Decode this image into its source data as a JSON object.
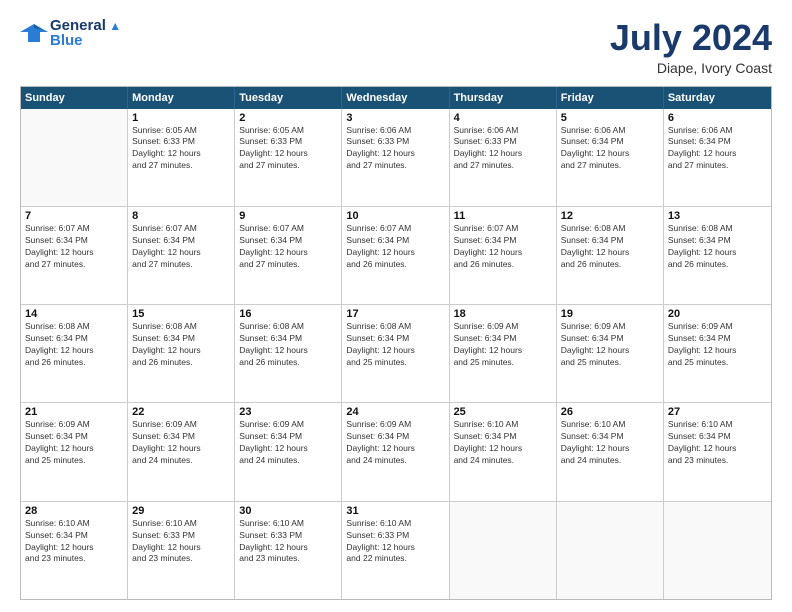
{
  "header": {
    "logo_line1": "General",
    "logo_line2": "Blue",
    "month_year": "July 2024",
    "location": "Diape, Ivory Coast"
  },
  "days_of_week": [
    "Sunday",
    "Monday",
    "Tuesday",
    "Wednesday",
    "Thursday",
    "Friday",
    "Saturday"
  ],
  "weeks": [
    [
      {
        "day": "",
        "info": ""
      },
      {
        "day": "1",
        "info": "Sunrise: 6:05 AM\nSunset: 6:33 PM\nDaylight: 12 hours\nand 27 minutes."
      },
      {
        "day": "2",
        "info": "Sunrise: 6:05 AM\nSunset: 6:33 PM\nDaylight: 12 hours\nand 27 minutes."
      },
      {
        "day": "3",
        "info": "Sunrise: 6:06 AM\nSunset: 6:33 PM\nDaylight: 12 hours\nand 27 minutes."
      },
      {
        "day": "4",
        "info": "Sunrise: 6:06 AM\nSunset: 6:33 PM\nDaylight: 12 hours\nand 27 minutes."
      },
      {
        "day": "5",
        "info": "Sunrise: 6:06 AM\nSunset: 6:34 PM\nDaylight: 12 hours\nand 27 minutes."
      },
      {
        "day": "6",
        "info": "Sunrise: 6:06 AM\nSunset: 6:34 PM\nDaylight: 12 hours\nand 27 minutes."
      }
    ],
    [
      {
        "day": "7",
        "info": "Sunrise: 6:07 AM\nSunset: 6:34 PM\nDaylight: 12 hours\nand 27 minutes."
      },
      {
        "day": "8",
        "info": "Sunrise: 6:07 AM\nSunset: 6:34 PM\nDaylight: 12 hours\nand 27 minutes."
      },
      {
        "day": "9",
        "info": "Sunrise: 6:07 AM\nSunset: 6:34 PM\nDaylight: 12 hours\nand 27 minutes."
      },
      {
        "day": "10",
        "info": "Sunrise: 6:07 AM\nSunset: 6:34 PM\nDaylight: 12 hours\nand 26 minutes."
      },
      {
        "day": "11",
        "info": "Sunrise: 6:07 AM\nSunset: 6:34 PM\nDaylight: 12 hours\nand 26 minutes."
      },
      {
        "day": "12",
        "info": "Sunrise: 6:08 AM\nSunset: 6:34 PM\nDaylight: 12 hours\nand 26 minutes."
      },
      {
        "day": "13",
        "info": "Sunrise: 6:08 AM\nSunset: 6:34 PM\nDaylight: 12 hours\nand 26 minutes."
      }
    ],
    [
      {
        "day": "14",
        "info": "Sunrise: 6:08 AM\nSunset: 6:34 PM\nDaylight: 12 hours\nand 26 minutes."
      },
      {
        "day": "15",
        "info": "Sunrise: 6:08 AM\nSunset: 6:34 PM\nDaylight: 12 hours\nand 26 minutes."
      },
      {
        "day": "16",
        "info": "Sunrise: 6:08 AM\nSunset: 6:34 PM\nDaylight: 12 hours\nand 26 minutes."
      },
      {
        "day": "17",
        "info": "Sunrise: 6:08 AM\nSunset: 6:34 PM\nDaylight: 12 hours\nand 25 minutes."
      },
      {
        "day": "18",
        "info": "Sunrise: 6:09 AM\nSunset: 6:34 PM\nDaylight: 12 hours\nand 25 minutes."
      },
      {
        "day": "19",
        "info": "Sunrise: 6:09 AM\nSunset: 6:34 PM\nDaylight: 12 hours\nand 25 minutes."
      },
      {
        "day": "20",
        "info": "Sunrise: 6:09 AM\nSunset: 6:34 PM\nDaylight: 12 hours\nand 25 minutes."
      }
    ],
    [
      {
        "day": "21",
        "info": "Sunrise: 6:09 AM\nSunset: 6:34 PM\nDaylight: 12 hours\nand 25 minutes."
      },
      {
        "day": "22",
        "info": "Sunrise: 6:09 AM\nSunset: 6:34 PM\nDaylight: 12 hours\nand 24 minutes."
      },
      {
        "day": "23",
        "info": "Sunrise: 6:09 AM\nSunset: 6:34 PM\nDaylight: 12 hours\nand 24 minutes."
      },
      {
        "day": "24",
        "info": "Sunrise: 6:09 AM\nSunset: 6:34 PM\nDaylight: 12 hours\nand 24 minutes."
      },
      {
        "day": "25",
        "info": "Sunrise: 6:10 AM\nSunset: 6:34 PM\nDaylight: 12 hours\nand 24 minutes."
      },
      {
        "day": "26",
        "info": "Sunrise: 6:10 AM\nSunset: 6:34 PM\nDaylight: 12 hours\nand 24 minutes."
      },
      {
        "day": "27",
        "info": "Sunrise: 6:10 AM\nSunset: 6:34 PM\nDaylight: 12 hours\nand 23 minutes."
      }
    ],
    [
      {
        "day": "28",
        "info": "Sunrise: 6:10 AM\nSunset: 6:34 PM\nDaylight: 12 hours\nand 23 minutes."
      },
      {
        "day": "29",
        "info": "Sunrise: 6:10 AM\nSunset: 6:33 PM\nDaylight: 12 hours\nand 23 minutes."
      },
      {
        "day": "30",
        "info": "Sunrise: 6:10 AM\nSunset: 6:33 PM\nDaylight: 12 hours\nand 23 minutes."
      },
      {
        "day": "31",
        "info": "Sunrise: 6:10 AM\nSunset: 6:33 PM\nDaylight: 12 hours\nand 22 minutes."
      },
      {
        "day": "",
        "info": ""
      },
      {
        "day": "",
        "info": ""
      },
      {
        "day": "",
        "info": ""
      }
    ]
  ]
}
